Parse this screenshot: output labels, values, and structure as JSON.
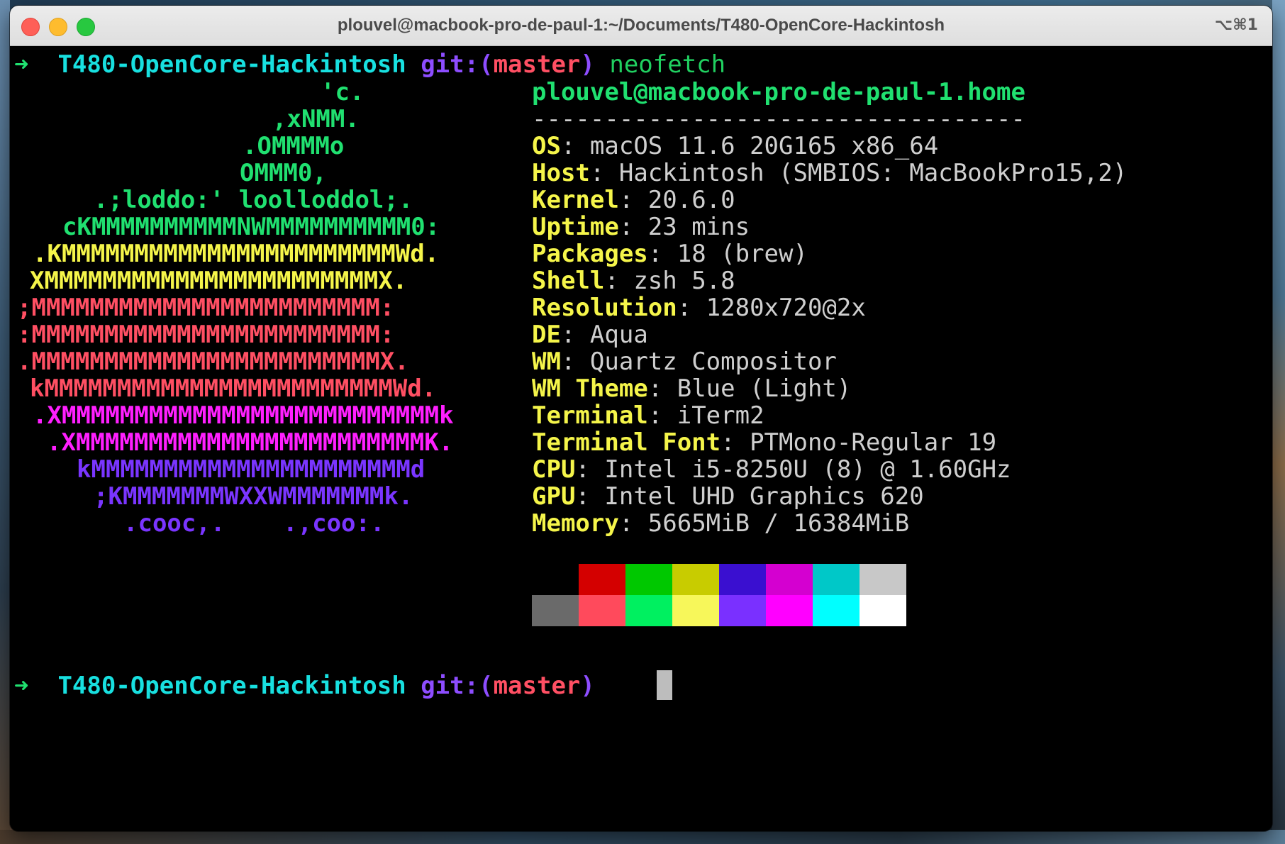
{
  "window": {
    "title": "plouvel@macbook-pro-de-paul-1:~/Documents/T480-OpenCore-Hackintosh",
    "shortcut": "⌥⌘1"
  },
  "prompt": {
    "arrow": "➜",
    "dir": "T480-OpenCore-Hackintosh",
    "git_prefix": "git:(",
    "branch": "master",
    "git_suffix": ")",
    "command": "neofetch"
  },
  "logo": [
    {
      "text": "'c.",
      "color": "green"
    },
    {
      "text": ",xNMM.",
      "color": "green"
    },
    {
      "text": ".OMMMMo",
      "color": "green"
    },
    {
      "text": "OMMM0,",
      "color": "green"
    },
    {
      "text": ".;loddo:' loolloddol;.",
      "color": "green"
    },
    {
      "text": "cKMMMMMMMMMMNWMMMMMMMMMM0:",
      "color": "green"
    },
    {
      "text": ".KMMMMMMMMMMMMMMMMMMMMMMMWd.",
      "color": "yellow"
    },
    {
      "text": "XMMMMMMMMMMMMMMMMMMMMMMMX.",
      "color": "yellow"
    },
    {
      "text": ";MMMMMMMMMMMMMMMMMMMMMMMM:",
      "color": "red"
    },
    {
      "text": ":MMMMMMMMMMMMMMMMMMMMMMMM:",
      "color": "red"
    },
    {
      "text": ".MMMMMMMMMMMMMMMMMMMMMMMMX.",
      "color": "red"
    },
    {
      "text": "kMMMMMMMMMMMMMMMMMMMMMMMMWd.",
      "color": "red"
    },
    {
      "text": ".XMMMMMMMMMMMMMMMMMMMMMMMMMMk",
      "color": "magenta"
    },
    {
      "text": ".XMMMMMMMMMMMMMMMMMMMMMMMMK.",
      "color": "magenta"
    },
    {
      "text": "kMMMMMMMMMMMMMMMMMMMMMMd",
      "color": "purple"
    },
    {
      "text": ";KMMMMMMMWXXWMMMMMMMk.",
      "color": "purple"
    },
    {
      "text": ".cooc,.    .,coo:.",
      "color": "purple"
    }
  ],
  "info": {
    "user_host": "plouvel@macbook-pro-de-paul-1.home",
    "separator": "----------------------------------",
    "rows": [
      {
        "key": "OS",
        "value": "macOS 11.6 20G165 x86_64"
      },
      {
        "key": "Host",
        "value": "Hackintosh (SMBIOS: MacBookPro15,2)"
      },
      {
        "key": "Kernel",
        "value": "20.6.0"
      },
      {
        "key": "Uptime",
        "value": "23 mins"
      },
      {
        "key": "Packages",
        "value": "18 (brew)"
      },
      {
        "key": "Shell",
        "value": "zsh 5.8"
      },
      {
        "key": "Resolution",
        "value": "1280x720@2x"
      },
      {
        "key": "DE",
        "value": "Aqua"
      },
      {
        "key": "WM",
        "value": "Quartz Compositor"
      },
      {
        "key": "WM Theme",
        "value": "Blue (Light)"
      },
      {
        "key": "Terminal",
        "value": "iTerm2"
      },
      {
        "key": "Terminal Font",
        "value": "PTMono-Regular 19"
      },
      {
        "key": "CPU",
        "value": "Intel i5-8250U (8) @ 1.60GHz"
      },
      {
        "key": "GPU",
        "value": "Intel UHD Graphics 620"
      },
      {
        "key": "Memory",
        "value": "5665MiB / 16384MiB"
      }
    ]
  },
  "palette": {
    "normal": [
      "#000000",
      "#d40000",
      "#00c800",
      "#c8cc00",
      "#3a0fd0",
      "#d400d0",
      "#00c8c8",
      "#c8c8c8"
    ],
    "bright": [
      "#6a6a6a",
      "#ff4a5c",
      "#00f060",
      "#f7f75a",
      "#7a30ff",
      "#ff00ff",
      "#00ffff",
      "#ffffff"
    ]
  }
}
